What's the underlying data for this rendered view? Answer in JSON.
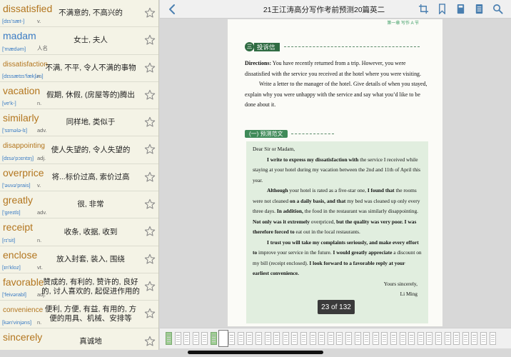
{
  "vocab": [
    {
      "word": "dissatisfied",
      "phonetic": "[dɪs'sæt-]",
      "pos": "v.",
      "meaning": "不满意的, 不高兴的",
      "color": "orange"
    },
    {
      "word": "madam",
      "phonetic": "['mædəm]",
      "pos": "人名",
      "meaning": "女士, 夫人",
      "color": "blue"
    },
    {
      "word": "dissatisfaction",
      "phonetic": "[dɪssætɪs'fækʃən]",
      "pos": "n.",
      "meaning": "不满, 不平, 令人不满的事物",
      "color": "orange",
      "small": true
    },
    {
      "word": "vacation",
      "phonetic": "[ve'k-]",
      "pos": "n.",
      "meaning": "假期, 休假, (房屋等的)腾出",
      "color": "orange"
    },
    {
      "word": "similarly",
      "phonetic": "['sɪmələ-lɪ]",
      "pos": "adv.",
      "meaning": "同样地, 类似于",
      "color": "orange"
    },
    {
      "word": "disappointing",
      "phonetic": "[dɪsə'pɔɪntɪŋ]",
      "pos": "adj.",
      "meaning": "使人失望的, 令人失望的",
      "color": "orange",
      "small": true
    },
    {
      "word": "overprice",
      "phonetic": "['əuvə'prais]",
      "pos": "v.",
      "meaning": "将...标价过高, 索价过高",
      "color": "orange"
    },
    {
      "word": "greatly",
      "phonetic": "['greɪtlɪ]",
      "pos": "adv.",
      "meaning": "很, 非常",
      "color": "orange"
    },
    {
      "word": "receipt",
      "phonetic": "[rɪ'sit]",
      "pos": "n.",
      "meaning": "收条, 收据, 收到",
      "color": "orange"
    },
    {
      "word": "enclose",
      "phonetic": "[ɪn'kloz]",
      "pos": "vt.",
      "meaning": "放入封套, 装入, 围绕",
      "color": "orange"
    },
    {
      "word": "favorable",
      "phonetic": "['feivərabl]",
      "pos": "adj.",
      "meaning": "赞成的, 有利的, 赞许的, 良好的, 讨人喜欢的, 起促进作用的",
      "color": "orange"
    },
    {
      "word": "convenience",
      "phonetic": "[kən'vinjəns]",
      "pos": "n.",
      "meaning": "便利, 方便, 有益, 有用的, 方便的用具、机械、安排等",
      "color": "orange",
      "small": true
    },
    {
      "word": "sincerely",
      "phonetic": "",
      "pos": "",
      "meaning": "真诚地",
      "color": "orange"
    }
  ],
  "toolbar": {
    "title": "21王江涛高分写作考前预测20篇英二"
  },
  "page": {
    "header": "第一章  写作 A 节",
    "section_num": "三",
    "section_label": "投诉信",
    "directions": [
      "Directions: You have recently returned from a trip. However, you were dissatisfied with the service you received at the hotel where you were visiting.",
      "Write a letter to the manager of the hotel. Give details of when you stayed, explain why you were unhappy with the service and say what you’d like to be done about it."
    ],
    "sample_label": "(一) 预测范文",
    "letter": {
      "greeting": "Dear Sir or Madam,",
      "p1_bold": "I write to express my dissatisfaction with",
      "p1_rest": " the service I received while staying at your hotel during my vacation between the 2nd and 11th of April this year.",
      "p2_bold1": "Although",
      "p2_a": " your hotel is rated as a five-star one, ",
      "p2_bold2": "I found that",
      "p2_b": " the rooms were not cleaned ",
      "p2_bold3": "on a daily basis, and that",
      "p2_c": " my bed was cleaned up only every three days. ",
      "p2_bold4": "In addition,",
      "p2_d": " the food in the restaurant was similarly disappointing. ",
      "p2_bold5": "Not only was it extremely",
      "p2_e": " overpriced, ",
      "p2_bold6": "but the quality was very poor. I was therefore forced to",
      "p2_f": " eat out in the local restaurants.",
      "p3_bold1": "I trust you will take my complaints seriously, and make every effort to",
      "p3_a": " improve your service in the future. ",
      "p3_bold2": "I would greatly appreciate",
      "p3_b": " a discount on my bill (receipt enclosed). ",
      "p3_bold3": "I look forward to a favorable reply at your earliest convenience.",
      "closing": "Yours sincerely,",
      "name": "Li Ming"
    }
  },
  "page_indicator": "23 of 132",
  "colors": {
    "accent_green": "#2f6b42",
    "word_orange": "#b3761f",
    "word_blue": "#3b7cc4",
    "letter_bg": "#e1eedf"
  }
}
